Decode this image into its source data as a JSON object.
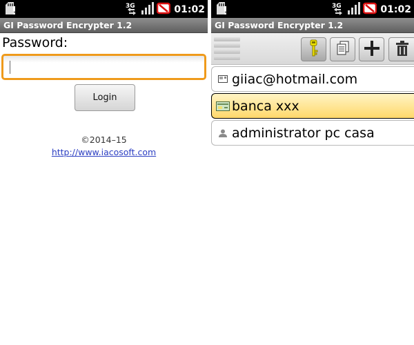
{
  "left": {
    "status": {
      "network": "3G",
      "time": "01:02"
    },
    "title": "GI Password Encrypter 1.2",
    "password_label": "Password:",
    "password_value": "",
    "login_label": "Login",
    "copyright": "©2014–15",
    "website": "http://www.iacosoft.com"
  },
  "right": {
    "status": {
      "network": "3G",
      "time": "01:02"
    },
    "title": "GI Password Encrypter 1.2",
    "toolbar": {
      "icons": [
        "menu-icon",
        "key-icon",
        "copy-document-icon",
        "add-icon",
        "trash-icon"
      ]
    },
    "entries": [
      {
        "label": "giiac@hotmail.com",
        "icon": "email-card-icon",
        "selected": false
      },
      {
        "label": "banca xxx",
        "icon": "bank-card-icon",
        "selected": true
      },
      {
        "label": "administrator pc casa",
        "icon": "user-icon",
        "selected": false
      }
    ]
  },
  "colors": {
    "focus_border": "#ef9a1b",
    "selected_row": "#ffd86b",
    "link": "#2b3ec2"
  }
}
